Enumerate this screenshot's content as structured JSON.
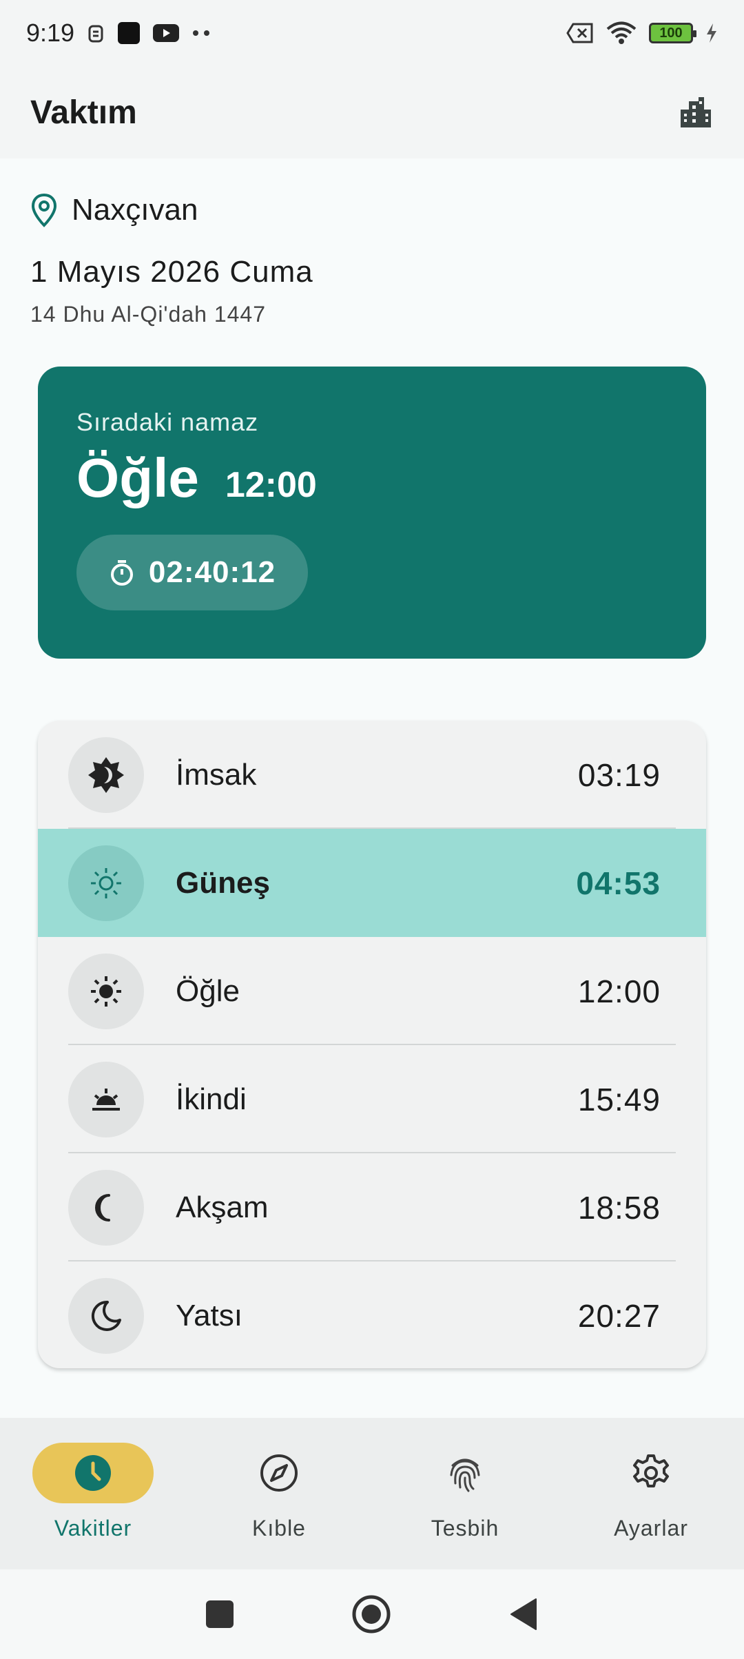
{
  "status_bar": {
    "time": "9:19",
    "battery": "100",
    "icons": [
      "notification-icon",
      "black-square-icon",
      "youtube-icon",
      "more-dots-icon",
      "sim-off-icon",
      "wifi-icon",
      "battery-icon",
      "charging-icon"
    ]
  },
  "app_bar": {
    "title": "Vaktım",
    "action_icon": "city-icon"
  },
  "location": {
    "name": "Naxçıvan",
    "icon": "location-pin-icon"
  },
  "date": {
    "gregorian": "1 Mayıs 2026 Cuma",
    "hijri": "14 Dhu Al-Qi'dah 1447"
  },
  "next_prayer": {
    "label": "Sıradaki namaz",
    "name": "Öğle",
    "time": "12:00",
    "countdown": "02:40:12",
    "countdown_icon": "timer-icon"
  },
  "prayer_times": [
    {
      "name": "İmsak",
      "time": "03:19",
      "icon": "brightness-dark-icon"
    },
    {
      "name": "Güneş",
      "time": "04:53",
      "icon": "sun-outline-icon",
      "active": true
    },
    {
      "name": "Öğle",
      "time": "12:00",
      "icon": "sun-filled-icon"
    },
    {
      "name": "İkindi",
      "time": "15:49",
      "icon": "sunset-icon"
    },
    {
      "name": "Akşam",
      "time": "18:58",
      "icon": "crescent-outline-icon"
    },
    {
      "name": "Yatsı",
      "time": "20:27",
      "icon": "moon-icon"
    }
  ],
  "bottom_nav": [
    {
      "label": "Vakitler",
      "icon": "clock-icon",
      "active": true
    },
    {
      "label": "Kıble",
      "icon": "compass-icon"
    },
    {
      "label": "Tesbih",
      "icon": "fingerprint-icon"
    },
    {
      "label": "Ayarlar",
      "icon": "gear-icon"
    }
  ],
  "colors": {
    "primary": "#11756b",
    "highlight_row": "#9adcd4",
    "nav_active_pill": "#e8c558"
  }
}
